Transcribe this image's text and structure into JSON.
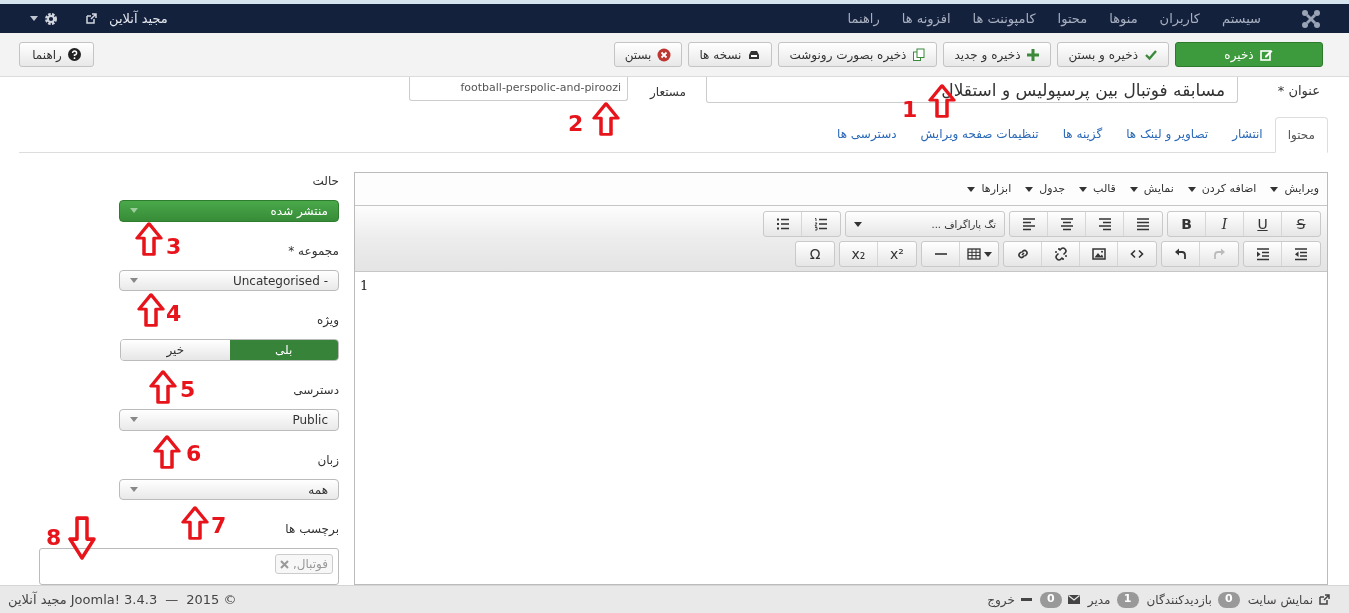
{
  "navbar": {
    "menu": [
      "سیستم",
      "کاربران",
      "منوها",
      "محتوا",
      "کامپوننت ها",
      "افزونه ها",
      "راهنما"
    ],
    "site_name": "مجید آنلاین"
  },
  "toolbar": {
    "buttons": [
      {
        "kind": "save",
        "label": "ذخیره"
      },
      {
        "kind": "save-close",
        "label": "ذخیره و بستن"
      },
      {
        "kind": "save-new",
        "label": "ذخیره و جدید"
      },
      {
        "kind": "save-copy",
        "label": "ذخیره بصورت رونوشت"
      },
      {
        "kind": "versions",
        "label": "نسخه ها"
      },
      {
        "kind": "close",
        "label": "بستن"
      }
    ],
    "help": "راهنما"
  },
  "title_field": {
    "label": "عنوان *",
    "value": "مسابقه فوتبال بین پرسپولیس و استقلال"
  },
  "alias_field": {
    "label": "مستعار",
    "value": "football-perspolic-and-piroozi"
  },
  "tabs": [
    {
      "label": "محتوا",
      "selected": true
    },
    {
      "label": "انتشار",
      "selected": false
    },
    {
      "label": "تصاویر و لینک ها",
      "selected": false
    },
    {
      "label": "گزینه ها",
      "selected": false
    },
    {
      "label": "تنظیمات صفحه ویرایش",
      "selected": false
    },
    {
      "label": "دسترسی ها",
      "selected": false
    }
  ],
  "editor": {
    "menu": [
      "ویرایش",
      "اضافه کردن",
      "نمایش",
      "قالب",
      "جدول",
      "ابزارها"
    ],
    "rows": [
      [
        [
          {
            "kind": "strike",
            "glyph": "S"
          },
          {
            "kind": "underline",
            "glyph": "U"
          },
          {
            "kind": "italic",
            "glyph": "I"
          },
          {
            "kind": "bold",
            "glyph": "B"
          }
        ],
        [
          {
            "kind": "justify"
          },
          {
            "kind": "align-right"
          },
          {
            "kind": "align-center"
          },
          {
            "kind": "align-left"
          }
        ],
        [
          {
            "kind": "dropdown",
            "label": "تگ پاراگراف ..."
          }
        ],
        [
          {
            "kind": "numbered-list"
          },
          {
            "kind": "bullet-list"
          }
        ]
      ],
      [
        [
          {
            "kind": "outdent"
          },
          {
            "kind": "indent"
          }
        ],
        [
          {
            "kind": "redo",
            "disabled": true
          },
          {
            "kind": "undo",
            "disabled": false
          }
        ],
        [
          {
            "kind": "code"
          },
          {
            "kind": "image"
          },
          {
            "kind": "unlink"
          },
          {
            "kind": "link"
          }
        ],
        [
          {
            "kind": "table"
          },
          {
            "kind": "hr"
          }
        ],
        [
          {
            "kind": "superscript",
            "glyph": "x²"
          },
          {
            "kind": "subscript",
            "glyph": "x₂"
          }
        ],
        [
          {
            "kind": "symbol",
            "glyph": "Ω"
          }
        ]
      ]
    ],
    "content": "1"
  },
  "side_fields": [
    {
      "kind": "select",
      "label": "حالت",
      "value": "منتشر شده",
      "highlighted": true
    },
    {
      "kind": "select",
      "label": "مجموعه *",
      "value": "- Uncategorised",
      "highlighted": false
    },
    {
      "kind": "toggle",
      "label": "ویژه",
      "options": [
        {
          "label": "بلی",
          "selected": true
        },
        {
          "label": "خیر",
          "selected": false
        }
      ]
    },
    {
      "kind": "select",
      "label": "دسترسی",
      "value": "Public",
      "highlighted": false
    },
    {
      "kind": "select",
      "label": "زبان",
      "value": "همه",
      "highlighted": false
    },
    {
      "kind": "tags",
      "label": "برچسب ها",
      "tags": [
        "فوتبال,"
      ]
    }
  ],
  "footer": {
    "status": [
      {
        "kind": "view-site",
        "label": "نمایش سایت"
      },
      {
        "kind": "count",
        "count": "0",
        "label": "بازدیدکنندگان"
      },
      {
        "kind": "count",
        "count": "1",
        "label": "مدیر"
      },
      {
        "kind": "messages",
        "count": "0"
      },
      {
        "kind": "logout",
        "label": "خروج"
      }
    ],
    "copyright": "© 2015",
    "separator": "—",
    "version": "Joomla! 3.4.3",
    "site": "مجید آنلاین"
  },
  "annotations": [
    {
      "label": "1"
    },
    {
      "label": "2"
    },
    {
      "label": "3"
    },
    {
      "label": "4"
    },
    {
      "label": "5"
    },
    {
      "label": "6"
    },
    {
      "label": "7"
    },
    {
      "label": "8"
    }
  ]
}
